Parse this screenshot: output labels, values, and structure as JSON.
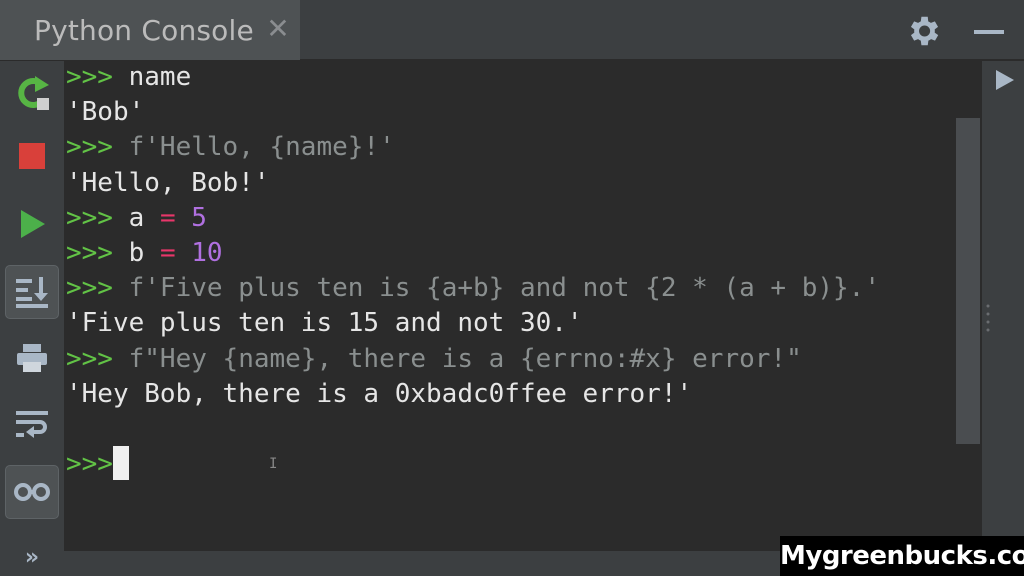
{
  "window": {
    "tab_title": "Python Console",
    "tab_close": "✕",
    "settings_icon": "gear-icon",
    "minimize_icon": "minimize-icon"
  },
  "toolbar": {
    "items": [
      {
        "name": "rerun",
        "icon": "rerun-icon"
      },
      {
        "name": "stop",
        "icon": "stop-icon"
      },
      {
        "name": "execute",
        "icon": "play-icon"
      },
      {
        "name": "scroll-to-end",
        "icon": "scroll-to-end-icon",
        "active": true
      },
      {
        "name": "print",
        "icon": "print-icon"
      },
      {
        "name": "soft-wrap",
        "icon": "soft-wrap-icon"
      },
      {
        "name": "show-variables",
        "icon": "glasses-icon",
        "active": true
      }
    ],
    "more_label": "»"
  },
  "colors": {
    "prompt": "#62c346",
    "operator": "#e8366a",
    "number": "#b070e0",
    "echo_code": "#8a8f8f",
    "output": "#e6e6e6"
  },
  "console": {
    "prompt": ">>>",
    "lines": [
      {
        "kind": "input",
        "code": "name"
      },
      {
        "kind": "output",
        "text": "'Bob'"
      },
      {
        "kind": "input",
        "code": "f'Hello, {name}!'"
      },
      {
        "kind": "output",
        "text": "'Hello, Bob!'"
      },
      {
        "kind": "input",
        "var": "a",
        "op": "=",
        "val": "5"
      },
      {
        "kind": "input",
        "var": "b",
        "op": "=",
        "val": "10"
      },
      {
        "kind": "input",
        "code": "f'Five plus ten is {a+b} and not {2 * (a + b)}.'"
      },
      {
        "kind": "output",
        "text": "'Five plus ten is 15 and not 30.'"
      },
      {
        "kind": "input",
        "code": "f\"Hey {name}, there is a {errno:#x} error!\""
      },
      {
        "kind": "output",
        "text": "'Hey Bob, there is a 0xbadc0ffee error!'"
      }
    ],
    "current_input": ""
  },
  "watermark": "Mygreenbucks.co.uk"
}
